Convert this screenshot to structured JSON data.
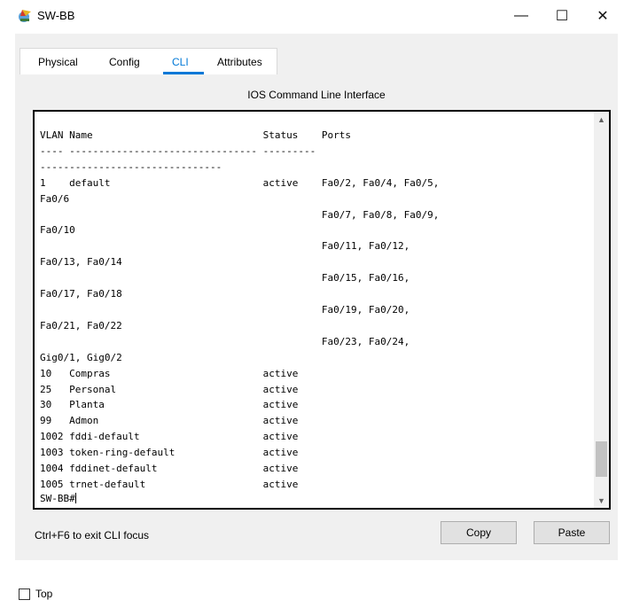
{
  "window": {
    "title": "SW-BB",
    "minimize": "—",
    "maximize": "☐",
    "close": "✕"
  },
  "tabs": [
    {
      "label": "Physical",
      "active": false
    },
    {
      "label": "Config",
      "active": false
    },
    {
      "label": "CLI",
      "active": true
    },
    {
      "label": "Attributes",
      "active": false
    }
  ],
  "cli": {
    "section_title": "IOS Command Line Interface",
    "output": "VLAN Name                             Status    Ports\n---- -------------------------------- ---------\n-------------------------------\n1    default                          active    Fa0/2, Fa0/4, Fa0/5,\nFa0/6\n                                                Fa0/7, Fa0/8, Fa0/9,\nFa0/10\n                                                Fa0/11, Fa0/12,\nFa0/13, Fa0/14\n                                                Fa0/15, Fa0/16,\nFa0/17, Fa0/18\n                                                Fa0/19, Fa0/20,\nFa0/21, Fa0/22\n                                                Fa0/23, Fa0/24,\nGig0/1, Gig0/2\n10   Compras                          active\n25   Personal                         active\n30   Planta                           active\n99   Admon                            active\n1002 fddi-default                     active\n1003 token-ring-default               active\n1004 fddinet-default                  active\n1005 trnet-default                    active",
    "prompt": "SW-BB#",
    "hint": "Ctrl+F6 to exit CLI focus",
    "copy_label": "Copy",
    "paste_label": "Paste"
  },
  "footer": {
    "top_label": "Top",
    "top_checked": false
  },
  "colors": {
    "accent": "#0078d7",
    "panel_bg": "#f0f0f0",
    "terminal_border": "#000000"
  }
}
